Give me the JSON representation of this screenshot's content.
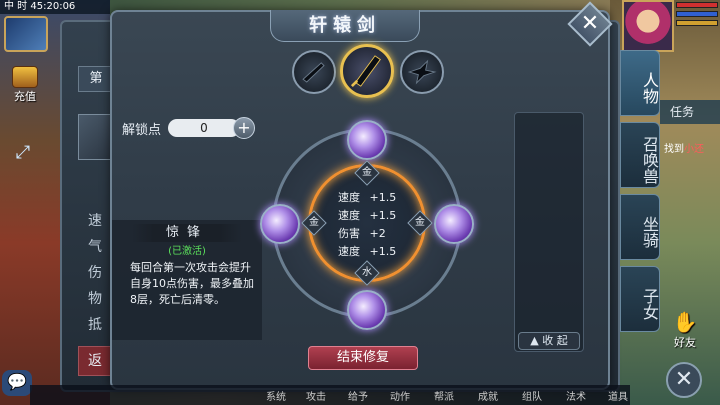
{
  "hud": {
    "clock": "45:20:06",
    "clock_prefix": "中 时",
    "recharge_label": "充值",
    "task_label": "任务",
    "quest_text_prefix": "找到",
    "quest_text_target": "小还",
    "friends_label": "好友"
  },
  "side_tabs": [
    {
      "label": "人物"
    },
    {
      "label": "召唤兽"
    },
    {
      "label": "坐骑"
    },
    {
      "label": "子女"
    }
  ],
  "bottom_bar": {
    "items": [
      "系统",
      "攻击",
      "给予",
      "动作",
      "帮派",
      "成就",
      "组队",
      "法术",
      "道具"
    ]
  },
  "back_panel": {
    "tab_label": "第",
    "stats": [
      "速",
      "气",
      "伤",
      "物",
      "抵"
    ],
    "return_label": "返"
  },
  "dialog": {
    "title": "轩辕剑",
    "close_label": "✕",
    "weapons": [
      {
        "name": "weapon-1"
      },
      {
        "name": "weapon-2",
        "active": true
      },
      {
        "name": "weapon-3"
      }
    ],
    "unlock": {
      "label": "解锁点",
      "value": "0",
      "plus": "+"
    },
    "skill": {
      "name": "惊锋",
      "status": "(已激活)",
      "description": "每回合第一次攻击会提升自身10点伤害，最多叠加8层，死亡后清零。"
    },
    "elements": {
      "top": "金",
      "left": "金",
      "right": "金",
      "bottom": "水"
    },
    "stats": [
      {
        "key": "速度",
        "value": "+1.5"
      },
      {
        "key": "速度",
        "value": "+1.5"
      },
      {
        "key": "伤害",
        "value": "+2"
      },
      {
        "key": "速度",
        "value": "+1.5"
      }
    ],
    "end_button": "结束修复",
    "collapse_button": "▲ 收 起"
  },
  "colors": {
    "accent_gold": "#e8c050",
    "ring_orange": "#f09030",
    "end_button": "#b04050",
    "active_green": "#5be05b"
  }
}
